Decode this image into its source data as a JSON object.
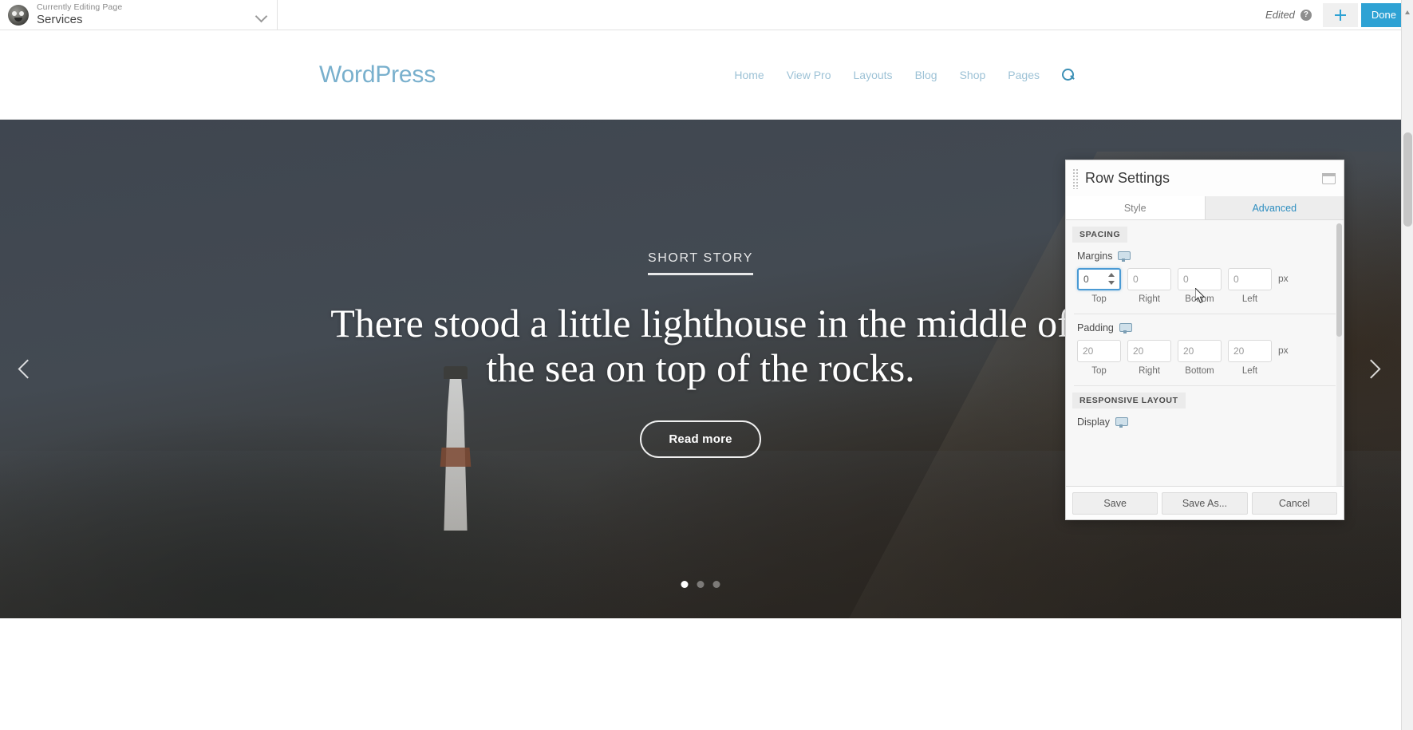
{
  "admin_bar": {
    "editing_label": "Currently Editing Page",
    "editing_title": "Services",
    "dropdown_icon": "chevron-down-icon",
    "status_text": "Edited",
    "help_icon": "?",
    "add_icon": "plus-icon",
    "done_label": "Done"
  },
  "site": {
    "logo_text": "WordPress",
    "nav": [
      {
        "label": "Home"
      },
      {
        "label": "View Pro"
      },
      {
        "label": "Layouts"
      },
      {
        "label": "Blog"
      },
      {
        "label": "Shop"
      },
      {
        "label": "Pages"
      }
    ],
    "search_icon": "search-icon"
  },
  "hero": {
    "eyebrow": "SHORT STORY",
    "title": "There stood a little lighthouse in the middle of the sea on top of the rocks.",
    "cta_label": "Read more",
    "prev_icon": "chevron-left-icon",
    "next_icon": "chevron-right-icon",
    "slides": [
      {
        "active": true
      },
      {
        "active": false
      },
      {
        "active": false
      }
    ]
  },
  "panel": {
    "title": "Row Settings",
    "minimize_icon": "minimize-window-icon",
    "drag_handle": "drag-grip-icon",
    "tabs": [
      {
        "label": "Style",
        "active": false
      },
      {
        "label": "Advanced",
        "active": true
      }
    ],
    "sections": [
      {
        "heading": "SPACING",
        "fields": [
          {
            "label": "Margins",
            "responsive_icon": "responsive-device-icon",
            "unit": "px",
            "inputs": [
              {
                "value": "0",
                "sub": "Top",
                "focused": true
              },
              {
                "value": "0",
                "sub": "Right",
                "focused": false
              },
              {
                "value": "0",
                "sub": "Bottom",
                "focused": false
              },
              {
                "value": "0",
                "sub": "Left",
                "focused": false
              }
            ]
          },
          {
            "label": "Padding",
            "responsive_icon": "responsive-device-icon",
            "unit": "px",
            "inputs": [
              {
                "value": "20",
                "sub": "Top",
                "focused": false
              },
              {
                "value": "20",
                "sub": "Right",
                "focused": false
              },
              {
                "value": "20",
                "sub": "Bottom",
                "focused": false
              },
              {
                "value": "20",
                "sub": "Left",
                "focused": false
              }
            ]
          }
        ]
      },
      {
        "heading": "RESPONSIVE LAYOUT",
        "fields": [
          {
            "label": "Display",
            "responsive_icon": "responsive-device-icon",
            "unit": "",
            "inputs": []
          }
        ]
      }
    ],
    "footer": {
      "save_label": "Save",
      "save_as_label": "Save As...",
      "cancel_label": "Cancel"
    }
  },
  "colors": {
    "accent_blue": "#2ea2d4",
    "tab_active_text": "#2e8ec0",
    "logo_blue": "#79b0cd",
    "nav_blue": "#9dc2d6",
    "focus_border": "#4a9ad4"
  }
}
